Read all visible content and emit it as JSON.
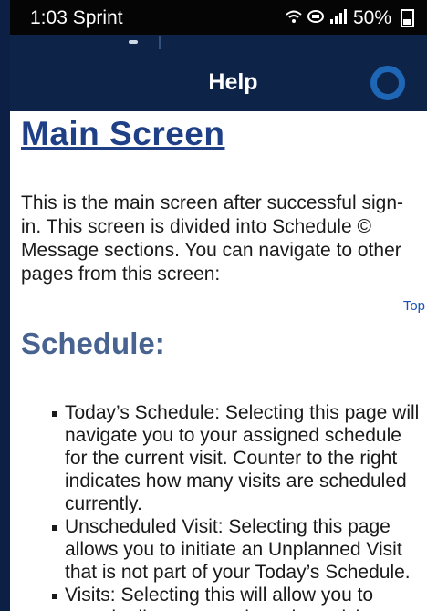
{
  "status_bar": {
    "time_carrier": "1:03 Sprint",
    "icons": [
      "wifi-icon",
      "volte-icon",
      "signal-icon"
    ],
    "battery": "50%"
  },
  "app_bar": {
    "title": "Help"
  },
  "help": {
    "title": "Main Screen",
    "intro": "This is the main screen after successful sign-in. This screen is divided into Schedule © Message sections. You can navigate to other pages from this screen:",
    "top_link": "Top",
    "schedule_heading": "Schedule:",
    "items": [
      "Today’s Schedule: Selecting this page will navigate you to your assigned schedule for the current visit. Counter to the right indicates how many visits are scheduled currently.",
      "Unscheduled Visit: Selecting this page allows you to initiate an Unplanned Visit that is not part of your Today’s Schedule.",
      "Visits: Selecting this will allow you to search all current and previous visits"
    ]
  },
  "colors": {
    "app_bar": "#0e2348",
    "status_bar": "#050505",
    "title_link": "#1f3f87",
    "section_heading": "#48638f",
    "top_link": "#1c52b8"
  }
}
